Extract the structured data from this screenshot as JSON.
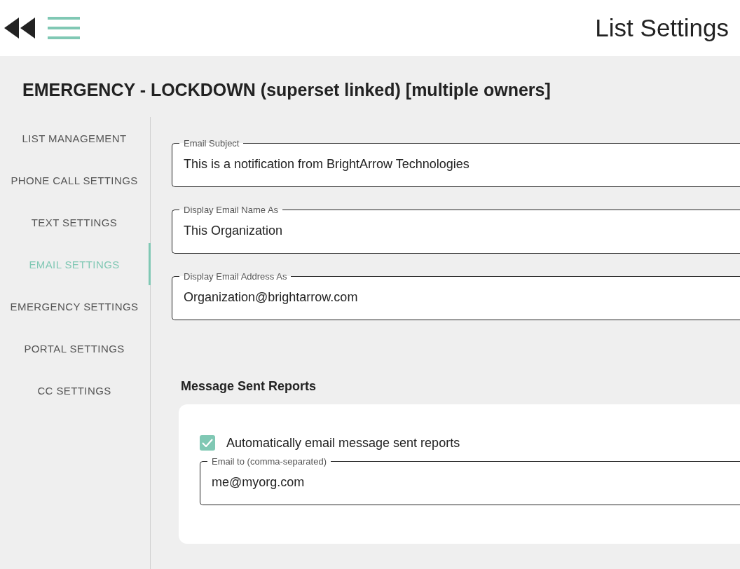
{
  "header": {
    "title": "List Settings"
  },
  "list_title": "EMERGENCY - LOCKDOWN (superset linked) [multiple owners]",
  "sidebar": {
    "items": [
      {
        "label": "LIST MANAGEMENT",
        "selected": false
      },
      {
        "label": "PHONE CALL SETTINGS",
        "selected": false
      },
      {
        "label": "TEXT SETTINGS",
        "selected": false
      },
      {
        "label": "EMAIL SETTINGS",
        "selected": true
      },
      {
        "label": "EMERGENCY SETTINGS",
        "selected": false
      },
      {
        "label": "PORTAL SETTINGS",
        "selected": false
      },
      {
        "label": "CC SETTINGS",
        "selected": false
      }
    ]
  },
  "fields": [
    {
      "label": "Email Subject",
      "value": "This is a notification from BrightArrow Technologies"
    },
    {
      "label": "Display Email Name As",
      "value": "This Organization"
    },
    {
      "label": "Display Email Address As",
      "value": "Organization@brightarrow.com"
    }
  ],
  "reports": {
    "heading": "Message Sent Reports",
    "checkbox": {
      "label": "Automatically email message sent reports",
      "checked": true
    },
    "email_to": {
      "label": "Email to (comma-separated)",
      "value": "me@myorg.com"
    }
  }
}
